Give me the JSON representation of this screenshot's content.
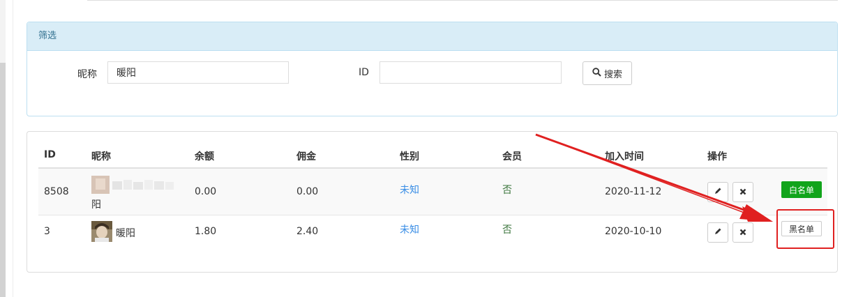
{
  "filter": {
    "heading": "筛选",
    "nickname_label": "昵称",
    "nickname_value": "暖阳",
    "id_label": "ID",
    "id_value": "",
    "search_label": "搜索"
  },
  "table": {
    "headers": [
      "ID",
      "昵称",
      "余额",
      "佣金",
      "性别",
      "会员",
      "加入时间",
      "操作"
    ],
    "rows": [
      {
        "id": "8508",
        "nickname": "阳",
        "balance": "0.00",
        "commission": "0.00",
        "gender": "未知",
        "member": "否",
        "joined": "2020-11-12",
        "list_button": "白名单"
      },
      {
        "id": "3",
        "nickname": "暖阳",
        "balance": "1.80",
        "commission": "2.40",
        "gender": "未知",
        "member": "否",
        "joined": "2020-10-10",
        "list_button": "黑名单"
      }
    ]
  },
  "colors": {
    "whitelist_button": "#11a41b",
    "annotation": "#e02020",
    "link": "#3a8ee6",
    "panel_heading_bg": "#d9edf7"
  },
  "icons": [
    "search-icon",
    "edit-pencil-icon",
    "delete-x-icon"
  ]
}
